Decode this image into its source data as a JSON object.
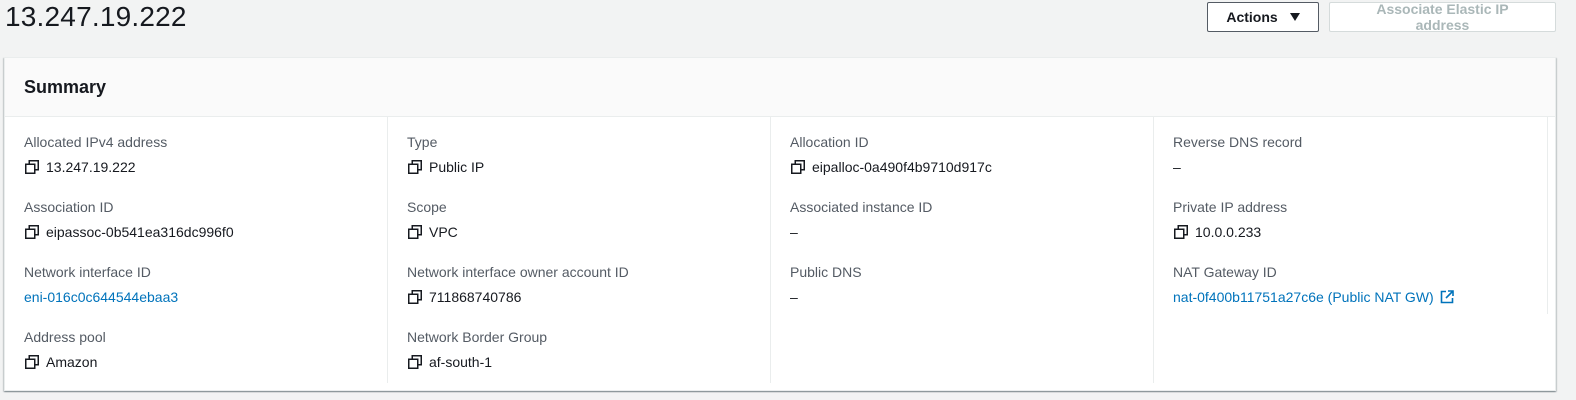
{
  "page": {
    "title": "13.247.19.222",
    "actions_label": "Actions",
    "associate_label": "Associate Elastic IP address"
  },
  "summary": {
    "title": "Summary",
    "columns": [
      [
        {
          "label": "Allocated IPv4 address",
          "value": "13.247.19.222",
          "copy": true
        },
        {
          "label": "Association ID",
          "value": "eipassoc-0b541ea316dc996f0",
          "copy": true
        },
        {
          "label": "Network interface ID",
          "value": "eni-016c0c644544ebaa3",
          "link": true
        },
        {
          "label": "Address pool",
          "value": "Amazon",
          "copy": true
        }
      ],
      [
        {
          "label": "Type",
          "value": "Public IP",
          "copy": true
        },
        {
          "label": "Scope",
          "value": "VPC",
          "copy": true
        },
        {
          "label": "Network interface owner account ID",
          "value": "711868740786",
          "copy": true
        },
        {
          "label": "Network Border Group",
          "value": "af-south-1",
          "copy": true
        }
      ],
      [
        {
          "label": "Allocation ID",
          "value": "eipalloc-0a490f4b9710d917c",
          "copy": true
        },
        {
          "label": "Associated instance ID",
          "value": "–"
        },
        {
          "label": "Public DNS",
          "value": "–"
        }
      ],
      [
        {
          "label": "Reverse DNS record",
          "value": "–"
        },
        {
          "label": "Private IP address",
          "value": "10.0.0.233",
          "copy": true
        },
        {
          "label": "NAT Gateway ID",
          "value": "nat-0f400b11751a27c6e (Public NAT GW)",
          "link": true,
          "external": true
        }
      ]
    ]
  },
  "icons": {
    "copy": "copy-icon",
    "external": "external-link-icon",
    "caret": "caret-down-icon"
  },
  "colors": {
    "link": "#0073bb",
    "label": "#545b64",
    "text": "#16191f",
    "disabled": "#aab7b8"
  }
}
